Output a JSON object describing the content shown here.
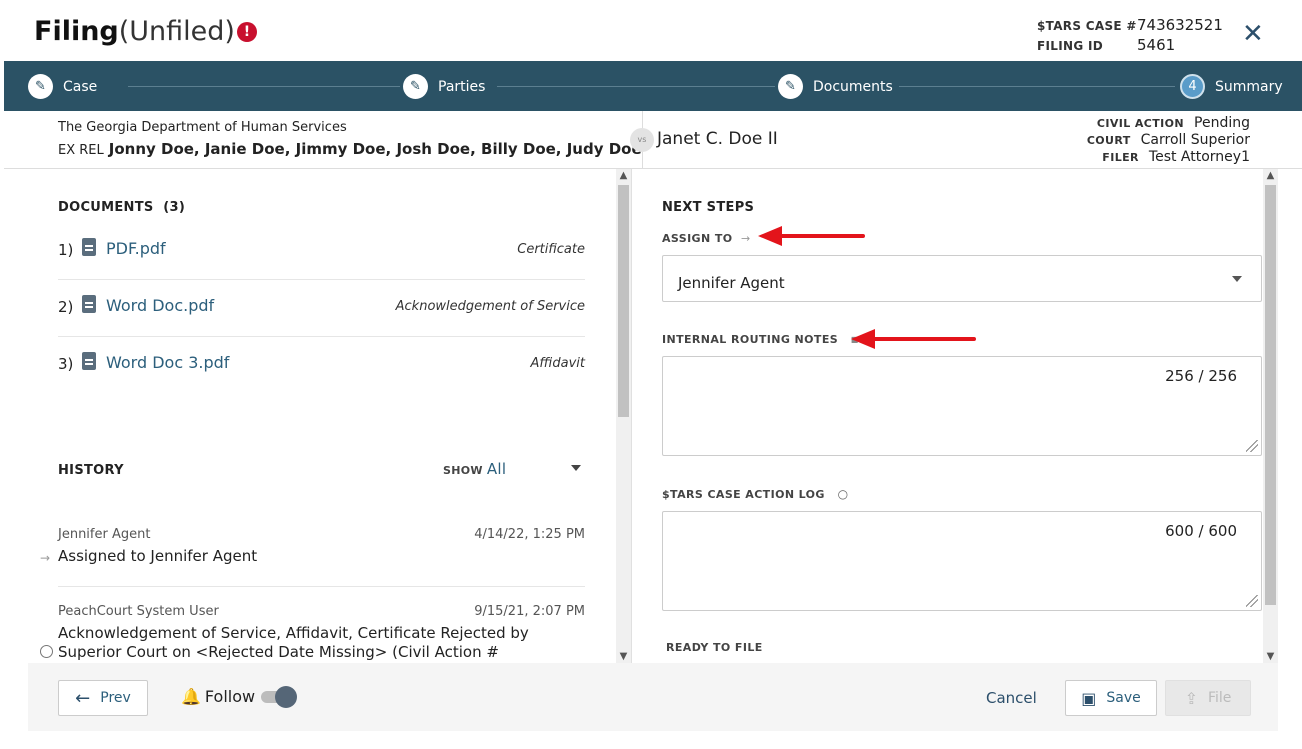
{
  "header": {
    "title": "Filing",
    "subtitle": "(Unfiled)",
    "alert_icon": "alert-circle-icon",
    "case_label": "$TARS CASE #",
    "case_value": "743632521",
    "filing_label": "FILING ID",
    "filing_value": "5461",
    "close_icon": "close-icon",
    "close_glyph": "✕"
  },
  "stepper": {
    "steps": [
      {
        "label": "Case",
        "glyph": "✎",
        "state": "done"
      },
      {
        "label": "Parties",
        "glyph": "✎",
        "state": "done"
      },
      {
        "label": "Documents",
        "glyph": "✎",
        "state": "done"
      },
      {
        "label": "Summary",
        "glyph": "4",
        "state": "current"
      }
    ]
  },
  "parties": {
    "plaintiff": "The Georgia Department of Human Services",
    "exrel_label": "EX REL",
    "exrel_names": "Jonny Doe, Janie Doe, Jimmy Doe, Josh Doe, Billy Doe, Judy Doe",
    "vs": "vs",
    "defendant": "Janet C. Doe II",
    "civil_action_label": "CIVIL ACTION",
    "civil_action_value": "Pending",
    "court_label": "COURT",
    "court_value": "Carroll Superior",
    "filer_label": "FILER",
    "filer_value": "Test Attorney1"
  },
  "documents": {
    "heading": "DOCUMENTS",
    "count": "(3)",
    "items": [
      {
        "num": "1)",
        "name": "PDF.pdf",
        "type": "Certificate"
      },
      {
        "num": "2)",
        "name": "Word Doc.pdf",
        "type": "Acknowledgement of Service"
      },
      {
        "num": "3)",
        "name": "Word Doc 3.pdf",
        "type": "Affidavit"
      }
    ]
  },
  "history": {
    "heading": "HISTORY",
    "show_label": "SHOW",
    "show_value": "All",
    "items": [
      {
        "who": "Jennifer Agent",
        "when": "4/14/22, 1:25 PM",
        "what": "Assigned to Jennifer Agent",
        "icon": "→"
      },
      {
        "who": "PeachCourt System User",
        "when": "9/15/21, 2:07 PM",
        "what": "Acknowledgement of Service, Affidavit, Certificate Rejected by Superior Court on <Rejected Date Missing> (Civil Action #",
        "icon": "○"
      }
    ]
  },
  "next_steps": {
    "heading": "NEXT STEPS",
    "assign_label": "ASSIGN TO",
    "assign_icon": "→",
    "assign_value": "Jennifer Agent",
    "routing_label": "INTERNAL ROUTING NOTES",
    "routing_icon": "■",
    "routing_count": "256 / 256",
    "log_label": "$TARS CASE ACTION LOG",
    "log_icon": "○",
    "log_count": "600 / 600",
    "ready_label": "READY TO FILE"
  },
  "footer": {
    "prev_label": "Prev",
    "prev_glyph": "←",
    "follow_label": "Follow",
    "bell_glyph": "🔔",
    "follow_on": true,
    "cancel_label": "Cancel",
    "save_label": "Save",
    "file_label": "File"
  },
  "colors": {
    "stepper_bg": "#2b5265",
    "link": "#2c5f7c",
    "alert": "#c8102e",
    "annotation_arrow": "#e3141b"
  }
}
